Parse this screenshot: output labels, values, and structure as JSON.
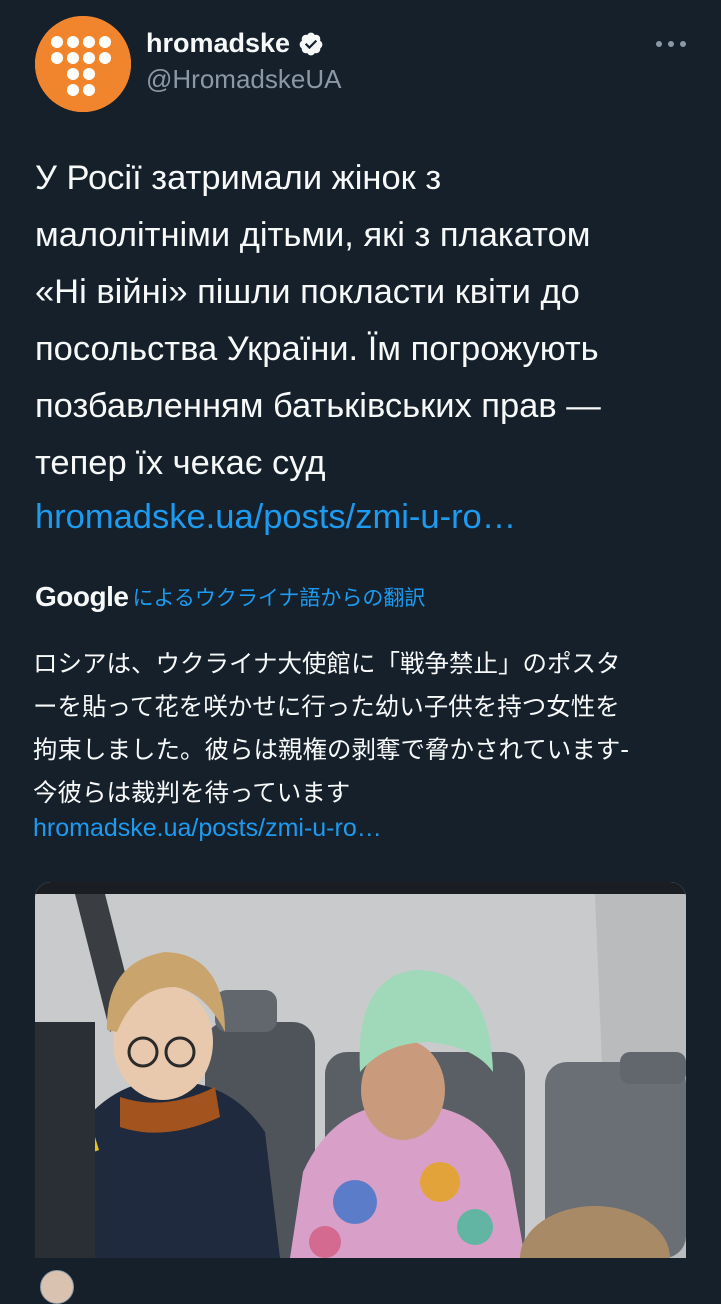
{
  "author": {
    "name": "hromadske",
    "handle": "@HromadskeUA",
    "verified": true,
    "avatar_icon": "hromadske-logo-icon",
    "avatar_color": "#f0852d"
  },
  "more_icon": "more-options-icon",
  "tweet": {
    "lines": [
      "У Росії затримали жінок з",
      "малолітніми дітьми, які з плакатом",
      "«Ні війні» пішли покласти квіти до",
      "посольства України. Їм погрожують",
      "позбавленням батьківських прав —",
      "тепер їх чекає суд"
    ],
    "link": "hromadske.ua/posts/zmi-u-ro…"
  },
  "translation": {
    "provider": "Google",
    "label": "によるウクライナ語からの翻訳",
    "lines": [
      "ロシアは、ウクライナ大使館に「戦争禁止」のポスタ",
      "ーを貼って花を咲かせに行った幼い子供を持つ女性を",
      "拘束しました。彼らは親権の剥奪で脅かされています-",
      "今彼らは裁判を待っています"
    ],
    "link": "hromadske.ua/posts/zmi-u-ro…"
  },
  "media": {
    "description_icon": "photo-children-on-bus"
  },
  "colors": {
    "background": "#15202b",
    "text": "#f7f9f9",
    "secondary": "#8b98a5",
    "link": "#1d9bf0"
  }
}
